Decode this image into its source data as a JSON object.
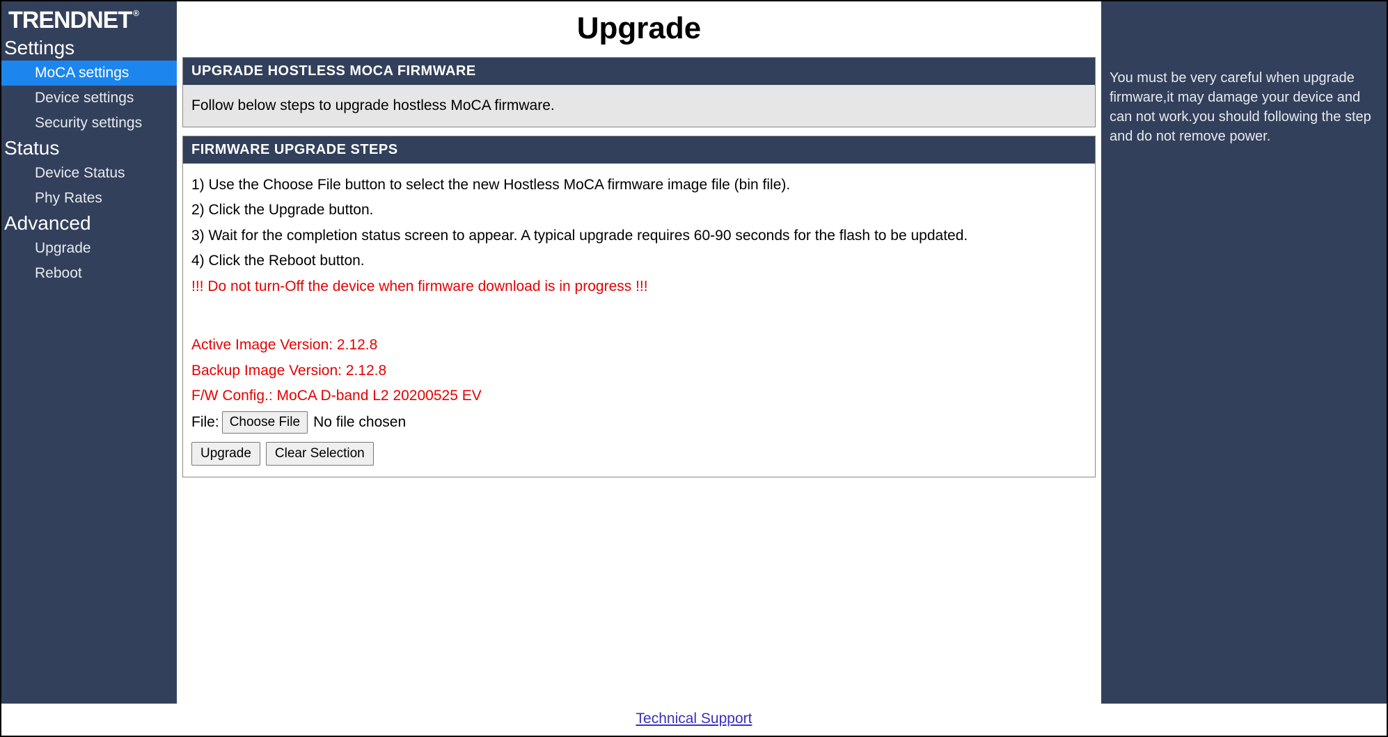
{
  "brand": "TRENDNET",
  "nav": {
    "sections": [
      {
        "title": "Settings",
        "items": [
          {
            "label": "MoCA settings",
            "active": true
          },
          {
            "label": "Device settings",
            "active": false
          },
          {
            "label": "Security settings",
            "active": false
          }
        ]
      },
      {
        "title": "Status",
        "items": [
          {
            "label": "Device Status",
            "active": false
          },
          {
            "label": "Phy Rates",
            "active": false
          }
        ]
      },
      {
        "title": "Advanced",
        "items": [
          {
            "label": "Upgrade",
            "active": false
          },
          {
            "label": "Reboot",
            "active": false
          }
        ]
      }
    ]
  },
  "page": {
    "title": "Upgrade"
  },
  "panel1": {
    "header": "UPGRADE HOSTLESS MOCA FIRMWARE",
    "intro": "Follow below steps to upgrade hostless MoCA firmware."
  },
  "panel2": {
    "header": "FIRMWARE UPGRADE STEPS",
    "steps": [
      "1) Use the Choose File button to select the new Hostless MoCA firmware image file (bin file).",
      "2) Click the Upgrade button.",
      "3) Wait for the completion status screen to appear. A typical upgrade requires 60-90 seconds for the flash to be updated.",
      "4) Click the Reboot button."
    ],
    "warning": "!!! Do not turn-Off the device when firmware download is in progress !!!",
    "active_version": "Active Image Version: 2.12.8",
    "backup_version": "Backup Image Version: 2.12.8",
    "fw_config": "F/W Config.: MoCA D-band L2 20200525 EV",
    "file_label": "File:",
    "choose_file": "Choose File",
    "no_file": "No file chosen",
    "upgrade_btn": "Upgrade",
    "clear_btn": "Clear Selection"
  },
  "help": {
    "text": "You must be very careful when upgrade firmware,it may damage your device and can not work.you should following the step and do not remove power."
  },
  "footer": {
    "link": "Technical Support"
  }
}
